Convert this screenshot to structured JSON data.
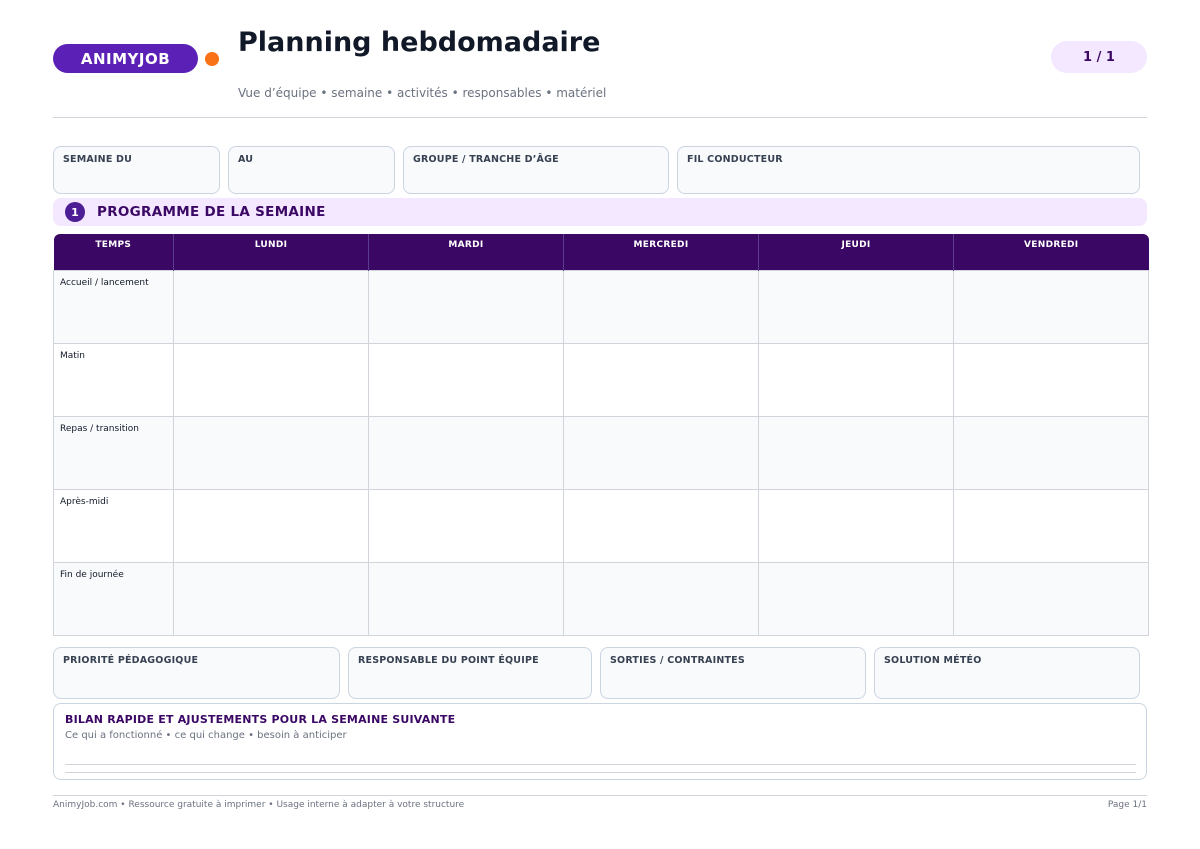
{
  "header": {
    "brand": "ANIMYJOB",
    "title": "Planning hebdomadaire",
    "subtitle": "Vue d’équipe • semaine • activités • responsables • matériel",
    "page_indicator": "1 / 1"
  },
  "top_fields": {
    "week_from": "SEMAINE DU",
    "week_to": "AU",
    "group": "GROUPE / TRANCHE D’ÂGE",
    "theme": "FIL CONDUCTEUR"
  },
  "section": {
    "number": "1",
    "title": "PROGRAMME DE LA SEMAINE"
  },
  "schedule": {
    "columns": [
      "TEMPS",
      "LUNDI",
      "MARDI",
      "MERCREDI",
      "JEUDI",
      "VENDREDI"
    ],
    "rows": [
      "Accueil / lancement",
      "Matin",
      "Repas / transition",
      "Après-midi",
      "Fin de journée"
    ]
  },
  "bottom_fields": {
    "priority": "PRIORITÉ PÉDAGOGIQUE",
    "lead": "RESPONSABLE DU POINT ÉQUIPE",
    "outings": "SORTIES / CONTRAINTES",
    "weather": "SOLUTION MÉTÉO"
  },
  "bilan": {
    "title": "BILAN RAPIDE ET AJUSTEMENTS POUR LA SEMAINE SUIVANTE",
    "subtitle": "Ce qui a fonctionné • ce qui change • besoin à anticiper"
  },
  "footer": {
    "left": "AnimyJob.com  •  Ressource gratuite à imprimer  •  Usage interne à adapter à votre structure",
    "right": "Page 1/1"
  },
  "colors": {
    "brand": "#5b21b6",
    "accent": "#f97316",
    "header_dark": "#3b0764",
    "section_bg": "#f3e8ff"
  }
}
